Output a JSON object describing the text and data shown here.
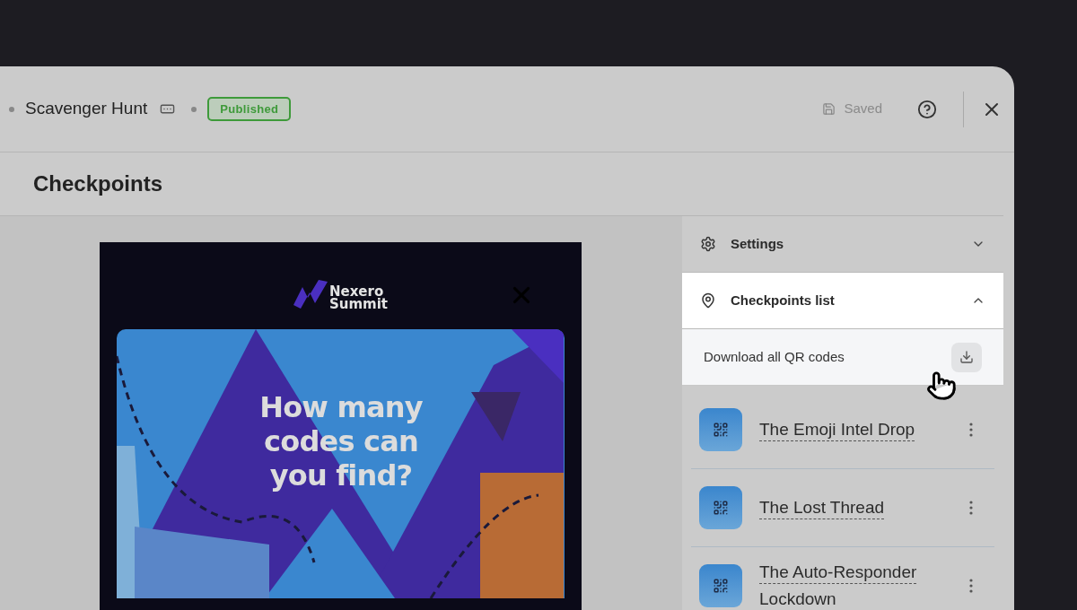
{
  "header": {
    "title": "Scavenger Hunt",
    "status": "Published",
    "save_status": "Saved"
  },
  "page_title": "Checkpoints",
  "preview": {
    "logo": {
      "line_1": "Nexero",
      "line_2": "Summit"
    },
    "headline": "How many codes can you find?"
  },
  "sidebar": {
    "sections": [
      {
        "kind": "settings",
        "label": "Settings",
        "expanded": false
      },
      {
        "kind": "checkpoints",
        "label": "Checkpoints list",
        "expanded": true
      }
    ],
    "download": {
      "label": "Download all QR codes"
    },
    "checkpoints": [
      {
        "name": "The Emoji Intel Drop"
      },
      {
        "name": "The Lost Thread"
      },
      {
        "name": "The Auto-Responder Lockdown"
      }
    ]
  }
}
